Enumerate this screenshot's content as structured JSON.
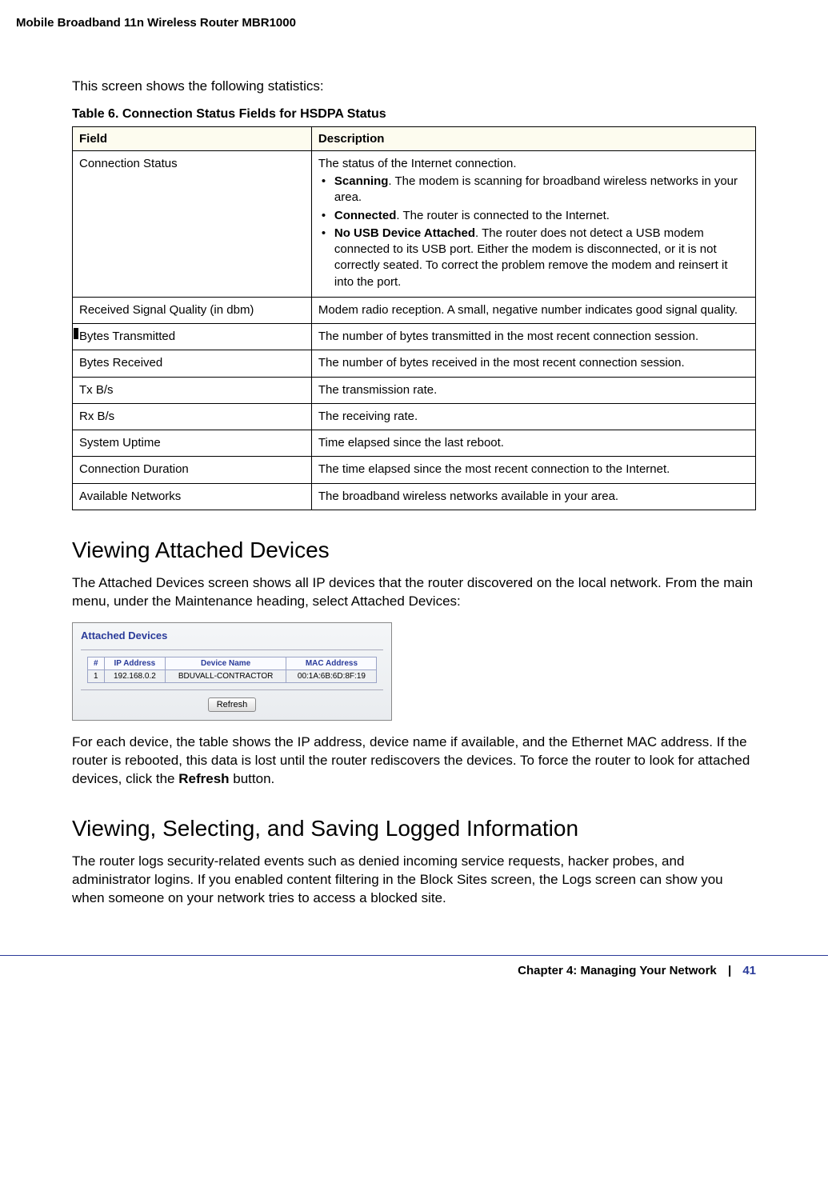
{
  "header": {
    "running": "Mobile Broadband 11n Wireless Router MBR1000"
  },
  "intro_text": "This screen shows the following statistics:",
  "table_caption": "Table 6.  Connection Status Fields for HSDPA Status",
  "columns": {
    "field": "Field",
    "description": "Description"
  },
  "rows": [
    {
      "field": "Connection Status",
      "intro": "The status of the Internet connection.",
      "bullets": [
        {
          "bold": "Scanning",
          "text": ". The modem is scanning for broadband wireless networks in your area."
        },
        {
          "bold": "Connected",
          "text": ". The router is connected to the Internet."
        },
        {
          "bold": "No USB Device Attached",
          "text": ". The router does not detect a USB modem connected to its USB port. Either the modem is disconnected, or it is not correctly seated. To correct the problem remove the modem and reinsert it into the port."
        }
      ]
    },
    {
      "field": "Received Signal Quality (in dbm)",
      "description": "Modem radio reception. A small, negative number indicates good signal quality."
    },
    {
      "field": "Bytes Transmitted",
      "description": "The number of bytes transmitted in the most recent connection session."
    },
    {
      "field": "Bytes Received",
      "description": "The number of bytes received in the most recent connection session."
    },
    {
      "field": "Tx B/s",
      "description": "The transmission rate."
    },
    {
      "field": "Rx B/s",
      "description": "The receiving rate."
    },
    {
      "field": "System Uptime",
      "description": "Time elapsed since the last reboot."
    },
    {
      "field": "Connection Duration",
      "description": "The time elapsed since the most recent connection to the Internet."
    },
    {
      "field": "Available Networks",
      "description": "The broadband wireless networks available in your area."
    }
  ],
  "section1": {
    "heading": "Viewing Attached Devices",
    "para1": "The Attached Devices screen shows all IP devices that the router discovered on the local network. From the main menu, under the Maintenance heading, select Attached Devices:",
    "screenshot": {
      "title": "Attached Devices",
      "cols": {
        "num": "#",
        "ip": "IP Address",
        "name": "Device Name",
        "mac": "MAC Address"
      },
      "row": {
        "num": "1",
        "ip": "192.168.0.2",
        "name": "BDUVALL-CONTRACTOR",
        "mac": "00:1A:6B:6D:8F:19"
      },
      "button": "Refresh"
    },
    "para2_a": "For each device, the table shows the IP address, device name if available, and the Ethernet MAC address. If the router is rebooted, this data is lost until the router rediscovers the devices. To force the router to look for attached devices, click the ",
    "para2_bold": "Refresh",
    "para2_b": " button."
  },
  "section2": {
    "heading": "Viewing, Selecting, and Saving Logged Information",
    "para": "The router logs security-related events such as denied incoming service requests, hacker probes, and administrator logins. If you enabled content filtering in the Block Sites screen, the Logs screen can show you when someone on your network tries to access a blocked site."
  },
  "footer": {
    "chapter": "Chapter 4:  Managing Your Network",
    "sep": "|",
    "page": "41"
  }
}
